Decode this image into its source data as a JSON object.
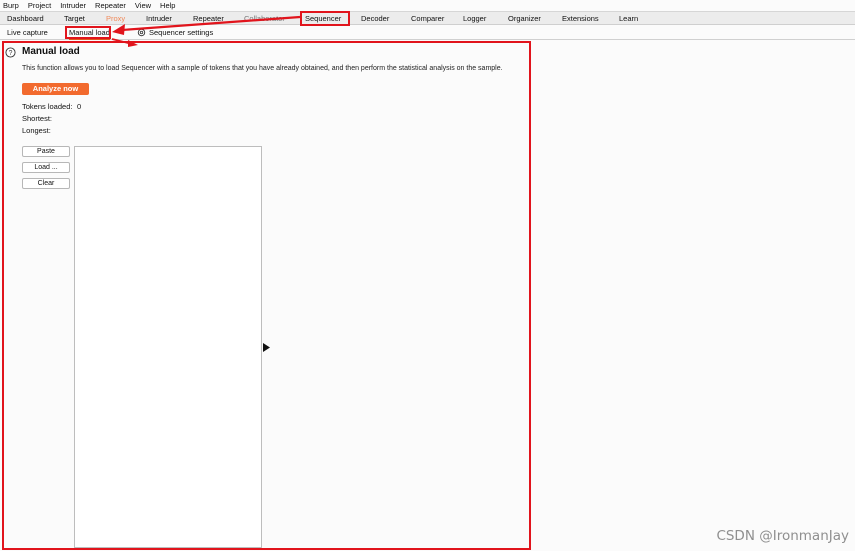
{
  "menubar": {
    "items": [
      "Burp",
      "Project",
      "Intruder",
      "Repeater",
      "View",
      "Help"
    ]
  },
  "tabs": {
    "items": [
      "Dashboard",
      "Target",
      "Proxy",
      "Intruder",
      "Repeater",
      "Collaborator",
      "Sequencer",
      "Decoder",
      "Comparer",
      "Logger",
      "Organizer",
      "Extensions",
      "Learn"
    ],
    "active": "Sequencer"
  },
  "subtabs": {
    "live_capture": "Live capture",
    "manual_load": "Manual load",
    "settings": "Sequencer settings"
  },
  "panel": {
    "title": "Manual load",
    "description": "This function allows you to load Sequencer with a sample of tokens that you have already obtained, and then perform the statistical analysis on the sample.",
    "analyze_label": "Analyze now",
    "tokens_loaded_label": "Tokens loaded:",
    "tokens_loaded_value": "0",
    "shortest_label": "Shortest:",
    "longest_label": "Longest:",
    "paste_label": "Paste",
    "load_label": "Load ...",
    "clear_label": "Clear"
  },
  "colors": {
    "accent": "#f26a2e",
    "annotation": "#e1141c"
  },
  "watermark": "CSDN @IronmanJay"
}
